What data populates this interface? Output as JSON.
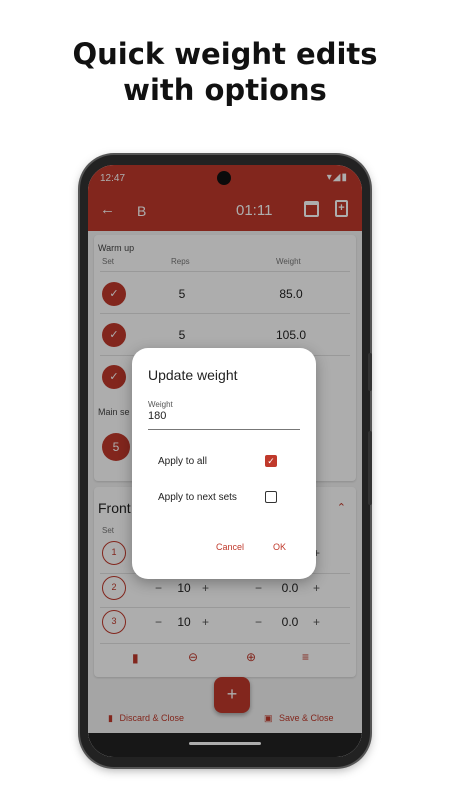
{
  "headline": {
    "line1": "Quick weight edits",
    "line2": "with options"
  },
  "status_bar": {
    "time": "12:47",
    "icons": "▾◢▮"
  },
  "app_bar": {
    "back_icon": "←",
    "title": "B",
    "timer": "01:11"
  },
  "warmup": {
    "title": "Warm up",
    "columns": {
      "set": "Set",
      "reps": "Reps",
      "weight": "Weight"
    },
    "rows": [
      {
        "check": "✓",
        "reps": "5",
        "weight": "85.0"
      },
      {
        "check": "✓",
        "reps": "5",
        "weight": "105.0"
      },
      {
        "check": "✓"
      }
    ]
  },
  "main": {
    "title": "Main se",
    "rows": [
      {
        "set": "5"
      }
    ]
  },
  "front": {
    "title": "Front",
    "columns": {
      "set": "Set"
    },
    "rows": [
      {
        "set": "1"
      },
      {
        "set": "2",
        "reps": "10",
        "weight": "0.0"
      },
      {
        "set": "3",
        "reps": "10",
        "weight": "0.0"
      }
    ],
    "minus": "−",
    "plus": "+",
    "chevron": "⌃"
  },
  "toolbar": {
    "delete_icon": "▮",
    "minus_icon": "⊖",
    "plus_icon": "⊕",
    "notes_icon": "≡"
  },
  "fab": {
    "label": "+"
  },
  "bottom": {
    "discard_icon": "▮",
    "discard": "Discard & Close",
    "save_icon": "▣",
    "save": "Save & Close"
  },
  "dialog": {
    "title": "Update weight",
    "field_label": "Weight",
    "field_value": "180",
    "options": [
      {
        "label": "Apply to all",
        "checked": true,
        "mark": "✓"
      },
      {
        "label": "Apply to next sets",
        "checked": false
      }
    ],
    "cancel": "Cancel",
    "ok": "OK"
  },
  "colors": {
    "accent": "#c0392b",
    "scrim": "rgba(0,0,0,0.32)"
  }
}
